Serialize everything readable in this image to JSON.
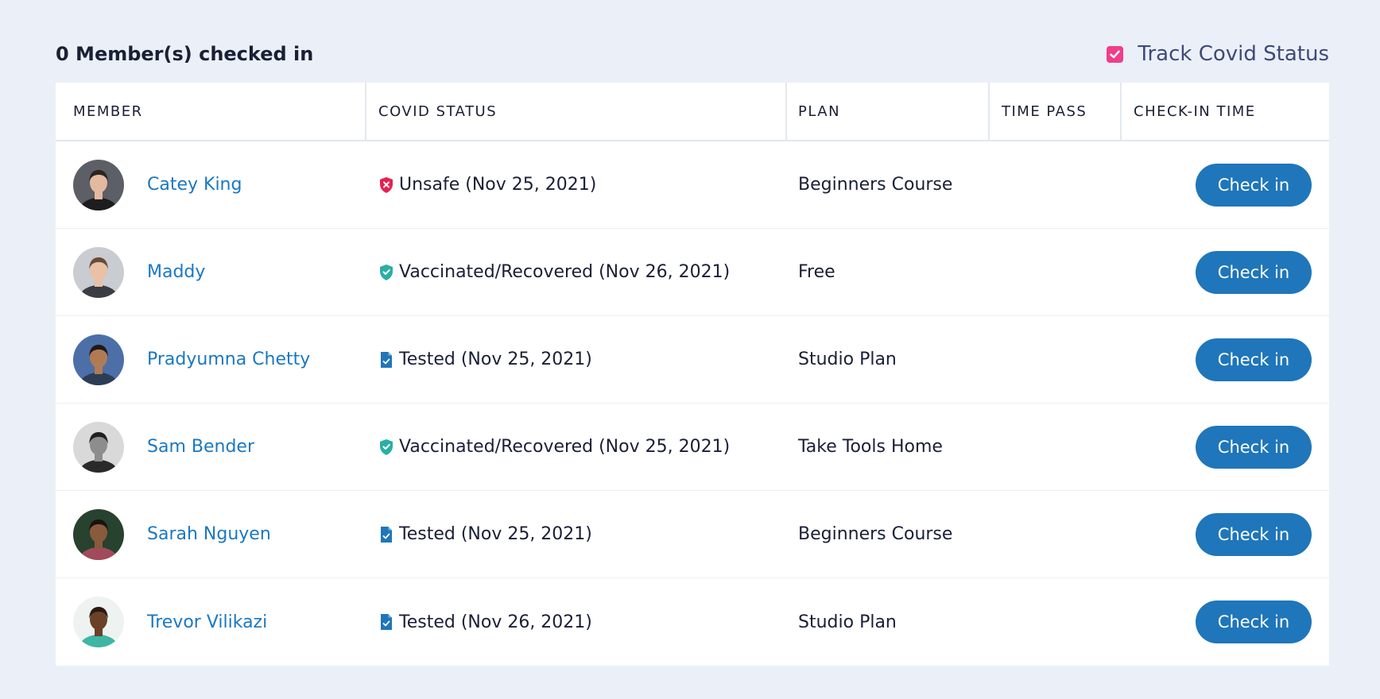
{
  "header": {
    "checked_in_title": "0 Member(s) checked in",
    "track_label": "Track Covid Status",
    "track_checked": true
  },
  "colors": {
    "accent": "#1f76ba",
    "link": "#1a78c2",
    "checkbox": "#ef3e8c",
    "unsafe": "#e8204f",
    "vaccinated": "#2aafa5",
    "tested": "#1f76ba",
    "background": "#ebf0f8"
  },
  "table": {
    "columns": [
      "MEMBER",
      "COVID STATUS",
      "PLAN",
      "TIME PASS",
      "CHECK-IN TIME"
    ],
    "rows": [
      {
        "name": "Catey King",
        "status_icon": "shield-x-icon",
        "status": "Unsafe (Nov 25, 2021)",
        "plan": "Beginners Course",
        "time_pass": "",
        "button": "Check in"
      },
      {
        "name": "Maddy",
        "status_icon": "shield-check-icon",
        "status": "Vaccinated/Recovered (Nov 26, 2021)",
        "plan": "Free",
        "time_pass": "",
        "button": "Check in"
      },
      {
        "name": "Pradyumna Chetty",
        "status_icon": "document-check-icon",
        "status": "Tested (Nov 25, 2021)",
        "plan": "Studio Plan",
        "time_pass": "",
        "button": "Check in"
      },
      {
        "name": "Sam Bender",
        "status_icon": "shield-check-icon",
        "status": "Vaccinated/Recovered (Nov 25, 2021)",
        "plan": "Take Tools Home",
        "time_pass": "",
        "button": "Check in"
      },
      {
        "name": "Sarah Nguyen",
        "status_icon": "document-check-icon",
        "status": "Tested (Nov 25, 2021)",
        "plan": "Beginners Course",
        "time_pass": "",
        "button": "Check in"
      },
      {
        "name": "Trevor Vilikazi",
        "status_icon": "document-check-icon",
        "status": "Tested (Nov 26, 2021)",
        "plan": "Studio Plan",
        "time_pass": "",
        "button": "Check in"
      }
    ]
  }
}
